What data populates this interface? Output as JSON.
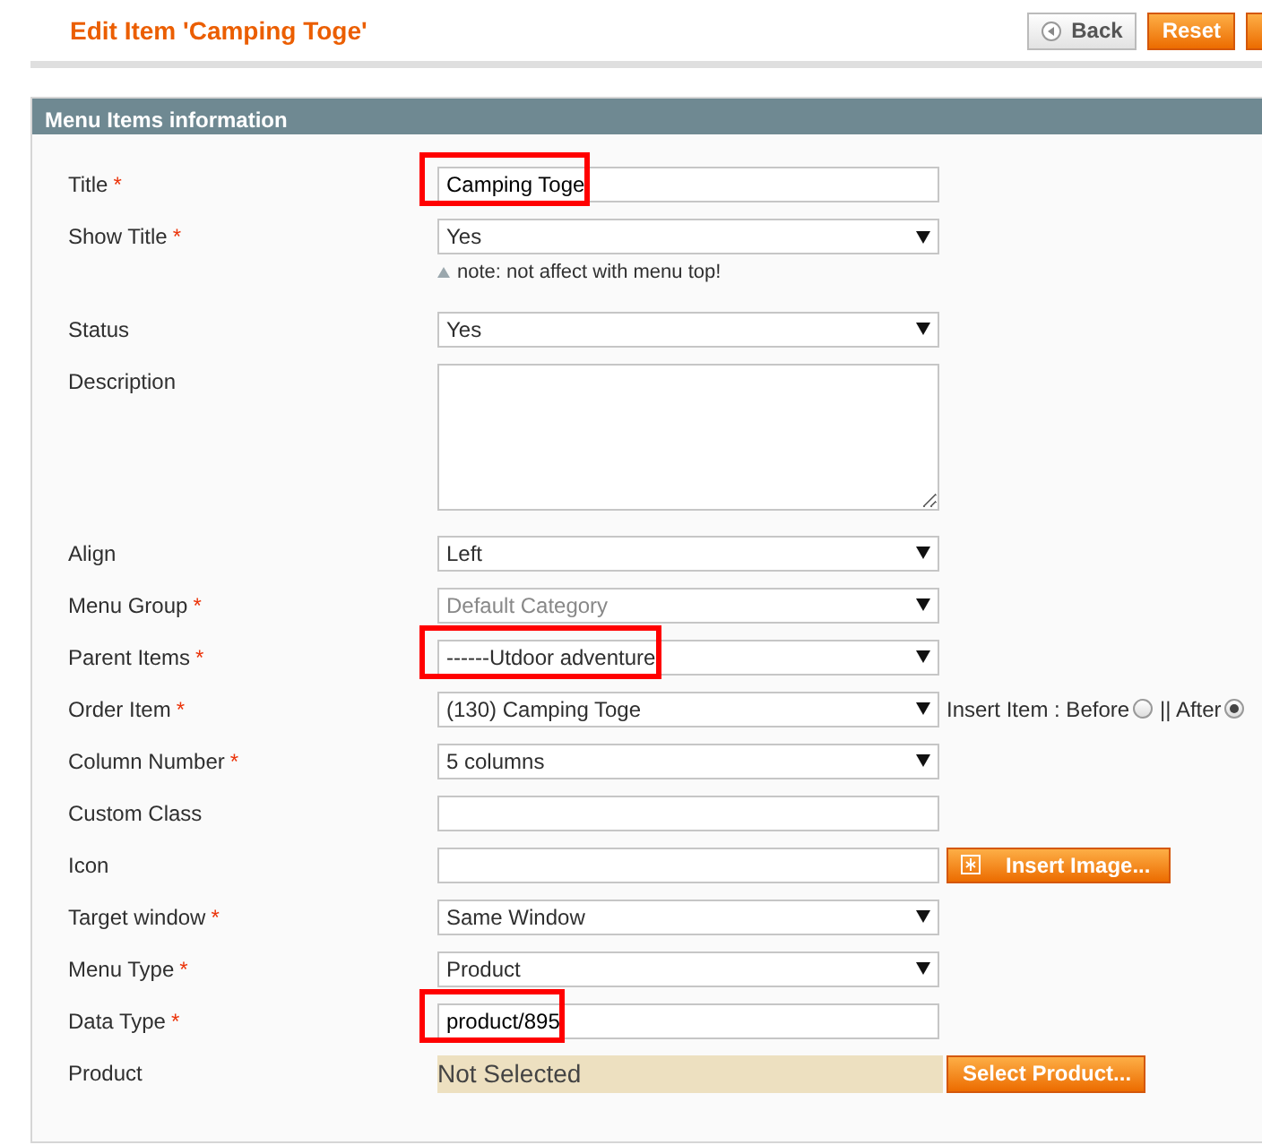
{
  "page_title": "Edit Item 'Camping Toge'",
  "header_buttons": [
    {
      "kind": "back",
      "label": "Back"
    },
    {
      "kind": "primary",
      "label": "Reset"
    },
    {
      "kind": "cut"
    }
  ],
  "section": {
    "title": "Menu Items information"
  },
  "fields": [
    {
      "kind": "text",
      "label": "Title",
      "required_mark": "*",
      "value": "Camping Toge",
      "highlighted": true
    },
    {
      "kind": "select",
      "label": "Show Title",
      "required_mark": "*",
      "value": "Yes",
      "note": "note: not affect with menu top!"
    },
    {
      "kind": "select",
      "label": "Status",
      "value": "Yes"
    },
    {
      "kind": "textarea",
      "label": "Description"
    },
    {
      "kind": "select",
      "label": "Align",
      "value": "Left"
    },
    {
      "kind": "select",
      "label": "Menu Group",
      "required_mark": "*",
      "value": "Default Category",
      "disabled": true
    },
    {
      "kind": "select",
      "label": "Parent Items",
      "required_mark": "*",
      "value": "------Utdoor adventure",
      "highlighted": true
    },
    {
      "kind": "select",
      "label": "Order Item",
      "required_mark": "*",
      "value": "(130) Camping Toge",
      "options": [
        {
          "label": "Insert Item : Before",
          "selected": false
        },
        {
          "label": "|| After",
          "selected": true
        }
      ]
    },
    {
      "kind": "select",
      "label": "Column Number",
      "required_mark": "*",
      "value": "5 columns"
    },
    {
      "kind": "text",
      "label": "Custom Class"
    },
    {
      "kind": "text",
      "label": "Icon",
      "button": "Insert Image..."
    },
    {
      "kind": "select",
      "label": "Target window",
      "required_mark": "*",
      "value": "Same Window"
    },
    {
      "kind": "select",
      "label": "Menu Type",
      "required_mark": "*",
      "value": "Product"
    },
    {
      "kind": "text",
      "label": "Data Type",
      "required_mark": "*",
      "value": "product/895",
      "highlighted": true
    },
    {
      "kind": "chooser",
      "label": "Product",
      "value": "Not Selected",
      "button": "Select Product..."
    }
  ]
}
